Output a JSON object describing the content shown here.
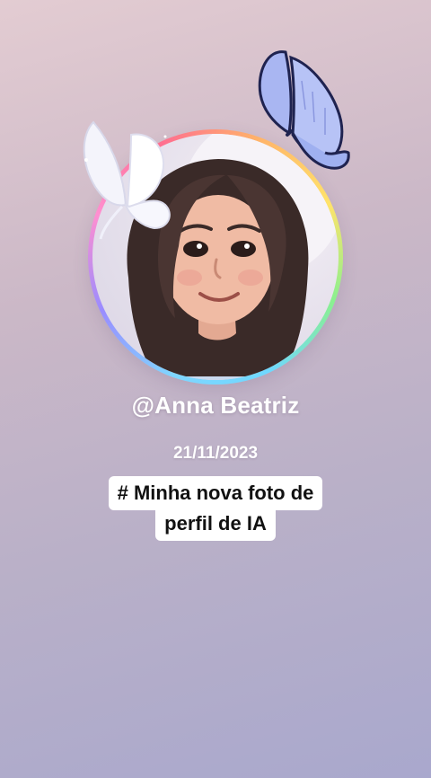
{
  "profile": {
    "username": "@Anna Beatriz",
    "date": "21/11/2023",
    "caption_line1": "# Minha nova foto de",
    "caption_line2": "perfil de IA"
  },
  "icons": {
    "butterfly_blue": "butterfly-icon",
    "butterfly_white": "butterfly-icon",
    "avatar": "avatar-illustration"
  },
  "colors": {
    "background_top": "#e3ccd2",
    "background_bottom": "#a9a8cd",
    "text": "#ffffff",
    "caption_bg": "#ffffff",
    "caption_text": "#111111",
    "butterfly_blue": "#a9b6f2"
  }
}
